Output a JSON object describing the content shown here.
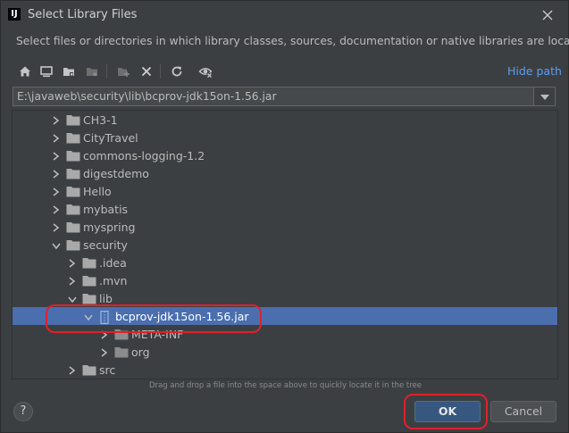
{
  "window": {
    "title": "Select Library Files",
    "app_icon_text": "IJ"
  },
  "description": "Select files or directories in which library classes, sources, documentation or native libraries are located",
  "toolbar": {
    "icons": [
      "home-icon",
      "desktop-icon",
      "project-folder-icon",
      "module-folder-icon",
      "new-folder-icon",
      "delete-icon",
      "refresh-icon",
      "show-hidden-icon"
    ],
    "hide_path": "Hide path"
  },
  "path": {
    "value": "E:\\javaweb\\security\\lib\\bcprov-jdk15on-1.56.jar"
  },
  "tree": {
    "items": [
      {
        "label": "CH3-1",
        "depth": 0,
        "expanded": false,
        "selected": false,
        "type": "folder"
      },
      {
        "label": "CityTravel",
        "depth": 0,
        "expanded": false,
        "selected": false,
        "type": "folder"
      },
      {
        "label": "commons-logging-1.2",
        "depth": 0,
        "expanded": false,
        "selected": false,
        "type": "folder"
      },
      {
        "label": "digestdemo",
        "depth": 0,
        "expanded": false,
        "selected": false,
        "type": "folder"
      },
      {
        "label": "Hello",
        "depth": 0,
        "expanded": false,
        "selected": false,
        "type": "folder"
      },
      {
        "label": "mybatis",
        "depth": 0,
        "expanded": false,
        "selected": false,
        "type": "folder"
      },
      {
        "label": "myspring",
        "depth": 0,
        "expanded": false,
        "selected": false,
        "type": "folder"
      },
      {
        "label": "security",
        "depth": 0,
        "expanded": true,
        "selected": false,
        "type": "folder"
      },
      {
        "label": ".idea",
        "depth": 1,
        "expanded": false,
        "selected": false,
        "type": "folder"
      },
      {
        "label": ".mvn",
        "depth": 1,
        "expanded": false,
        "selected": false,
        "type": "folder"
      },
      {
        "label": "lib",
        "depth": 1,
        "expanded": true,
        "selected": false,
        "type": "folder"
      },
      {
        "label": "bcprov-jdk15on-1.56.jar",
        "depth": 2,
        "expanded": true,
        "selected": true,
        "type": "jar"
      },
      {
        "label": "META-INF",
        "depth": 3,
        "expanded": false,
        "selected": false,
        "type": "folder"
      },
      {
        "label": "org",
        "depth": 3,
        "expanded": false,
        "selected": false,
        "type": "folder"
      },
      {
        "label": "src",
        "depth": 1,
        "expanded": false,
        "selected": false,
        "type": "folder"
      }
    ]
  },
  "hint": "Drag and drop a file into the space above to quickly locate it in the tree",
  "buttons": {
    "help": "?",
    "ok": "OK",
    "cancel": "Cancel"
  },
  "colors": {
    "background": "#3c3f41",
    "selection": "#4b6eaf",
    "link": "#589df6",
    "ok_button": "#365880",
    "annotation": "#e0202c"
  }
}
